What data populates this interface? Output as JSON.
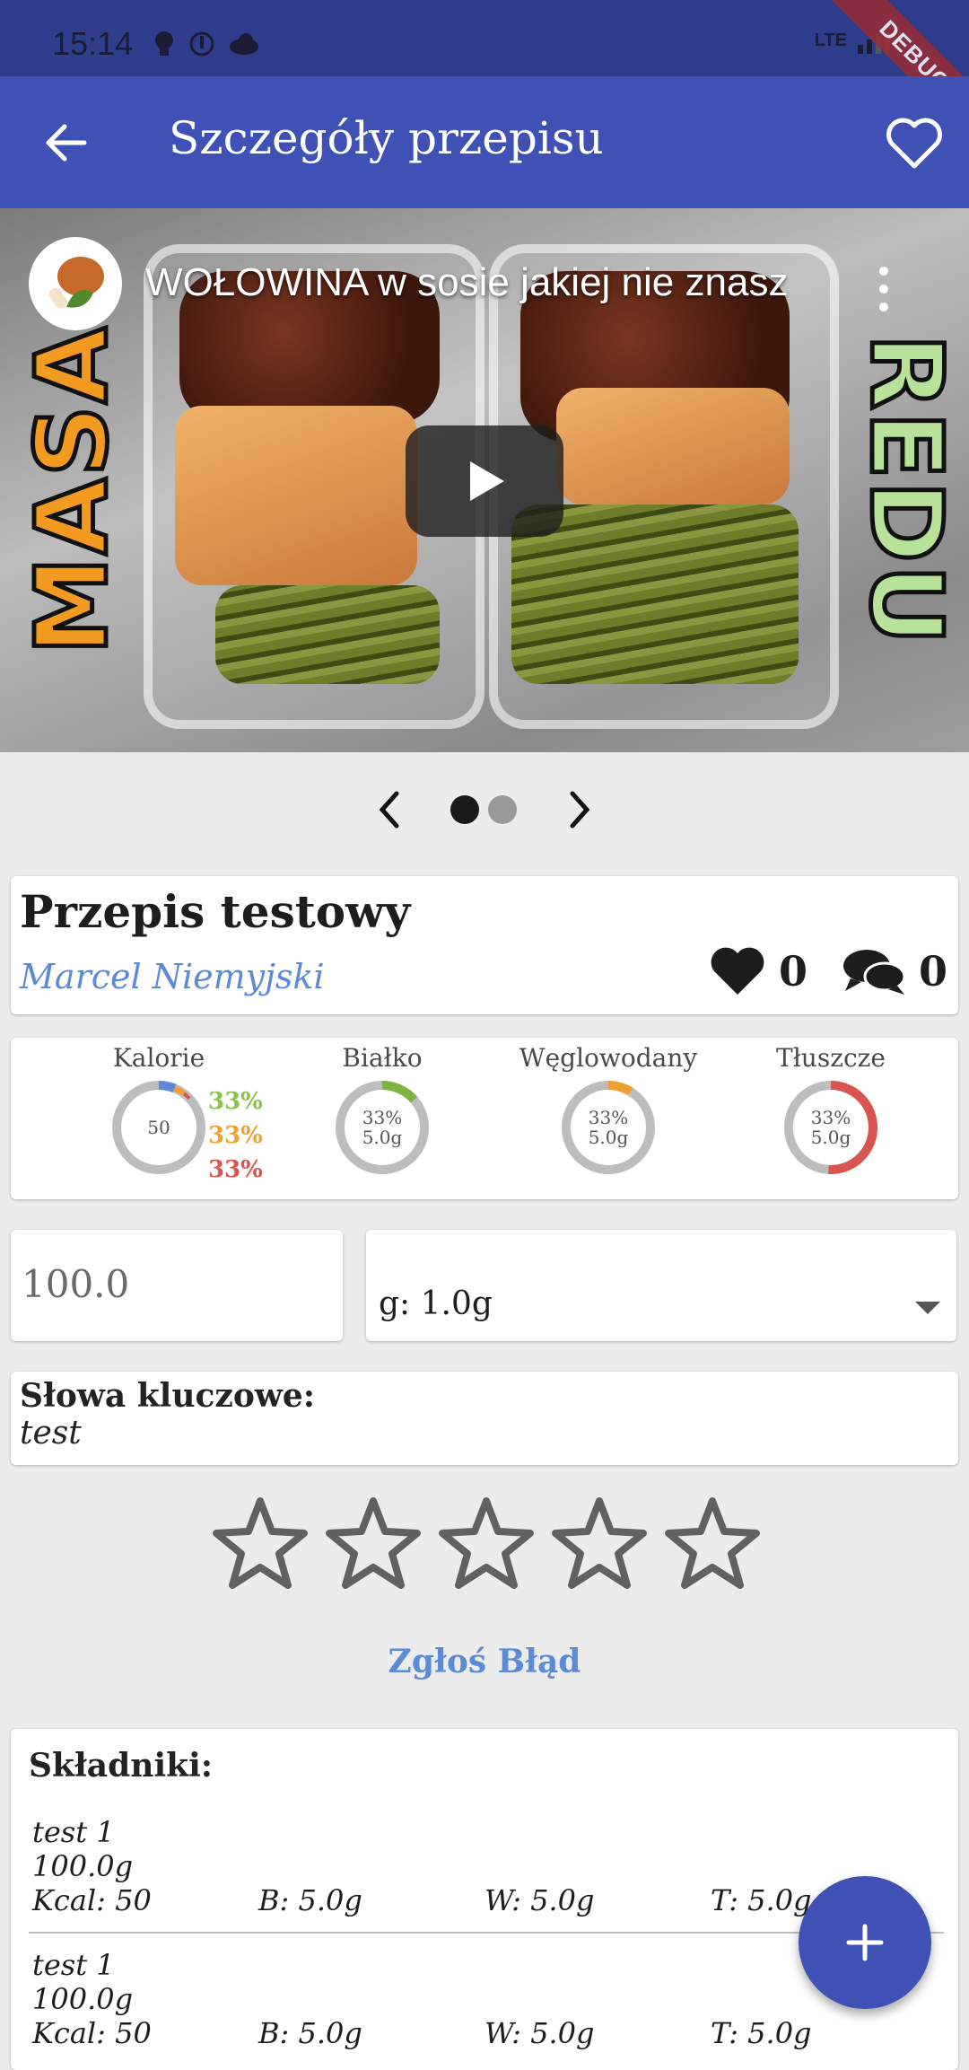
{
  "status_bar": {
    "time": "15:14",
    "network": "LTE",
    "debug_label": "DEBUG"
  },
  "app_bar": {
    "title": "Szczegóły przepisu"
  },
  "video": {
    "title": "WOŁOWINA w sosie jakiej nie znasz",
    "left_word": "MASA",
    "right_word": "REDU"
  },
  "carousel": {
    "pages": 2,
    "current": 1
  },
  "recipe": {
    "title": "Przepis testowy",
    "author": "Marcel Niemyjski",
    "likes": "0",
    "comments": "0"
  },
  "nutrition": {
    "calories": {
      "label": "Kalorie",
      "value": "50",
      "pct_protein": "33%",
      "pct_carbs": "33%",
      "pct_fat": "33%"
    },
    "protein": {
      "label": "Białko",
      "pct": "33%",
      "grams": "5.0g",
      "color": "#7cb342"
    },
    "carbs": {
      "label": "Węglowodany",
      "pct": "33%",
      "grams": "5.0g",
      "color": "#f0a030"
    },
    "fat": {
      "label": "Tłuszcze",
      "pct": "33%",
      "grams": "5.0g",
      "color": "#d9534f"
    }
  },
  "portion": {
    "amount": "100.0",
    "unit": "g: 1.0g"
  },
  "keywords": {
    "label": "Słowa kluczowe:",
    "value": "test"
  },
  "rating": {
    "stars": 0,
    "max": 5
  },
  "report_label": "Zgłoś Błąd",
  "ingredients": {
    "title": "Składniki:",
    "items": [
      {
        "name": "test 1",
        "amount": "100.0g",
        "kcal": "Kcal: 50",
        "b": "B: 5.0g",
        "w": "W: 5.0g",
        "t": "T: 5.0g"
      },
      {
        "name": "test 1",
        "amount": "100.0g",
        "kcal": "Kcal: 50",
        "b": "B: 5.0g",
        "w": "W: 5.0g",
        "t": "T: 5.0g"
      }
    ]
  },
  "colors": {
    "primary": "#3f51b5",
    "link": "#5b8ad6"
  }
}
